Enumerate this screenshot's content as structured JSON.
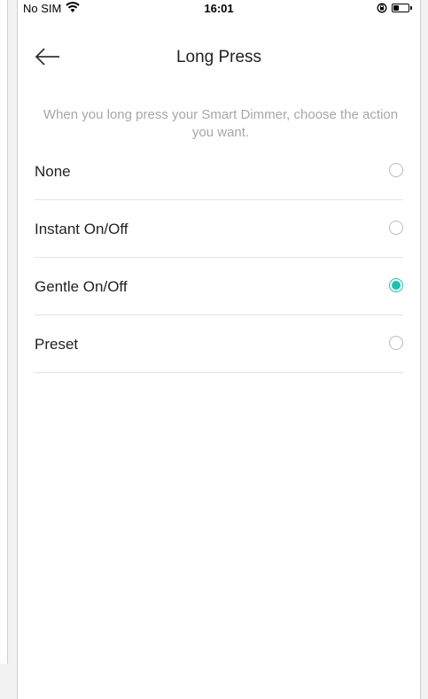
{
  "status_bar": {
    "carrier": "No SIM",
    "time": "16:01",
    "icons": [
      "wifi-icon",
      "orientation-lock-icon",
      "battery-icon"
    ]
  },
  "header": {
    "title": "Long Press",
    "back_icon": "arrow-left-icon"
  },
  "description": "When you long press your Smart Dimmer, choose the action you want.",
  "options": [
    {
      "label": "None",
      "selected": false
    },
    {
      "label": "Instant On/Off",
      "selected": false
    },
    {
      "label": "Gentle On/Off",
      "selected": true
    },
    {
      "label": "Preset",
      "selected": false
    }
  ],
  "colors": {
    "accent": "#18c3ad",
    "text": "#222222",
    "muted": "#a7a7a7",
    "divider": "#e3e3e3"
  }
}
